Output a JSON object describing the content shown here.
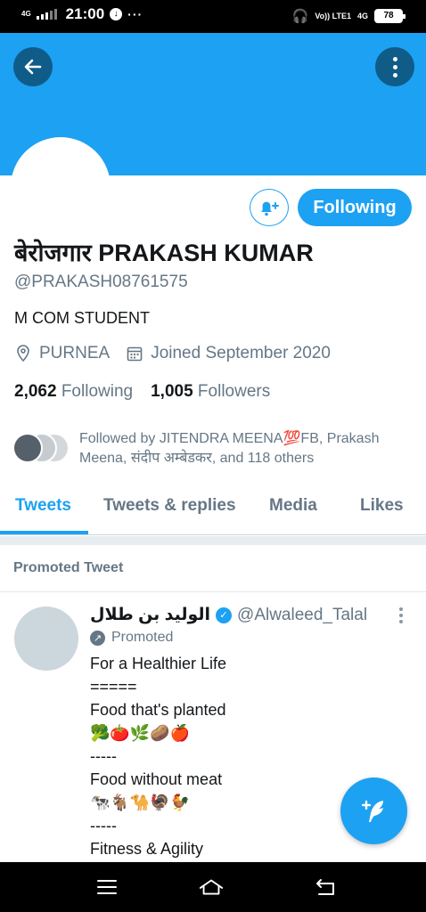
{
  "status_bar": {
    "network": "4G",
    "time": "21:00",
    "more": "···",
    "volte": "Vo)) LTE1",
    "net_right": "4G",
    "battery": "78"
  },
  "profile": {
    "name": "बेरोजगार PRAKASH KUMAR",
    "handle": "@PRAKASH08761575",
    "bio": "M COM STUDENT",
    "location": "PURNEA",
    "joined": "Joined September 2020",
    "following_count": "2,062",
    "following_label": "Following",
    "followers_count": "1,005",
    "followers_label": "Followers",
    "followed_by": "Followed by JITENDRA MEENA💯FB, Prakash Meena, संदीप अम्बेडकर, and 118 others"
  },
  "actions": {
    "follow_state": "Following"
  },
  "tabs": [
    {
      "label": "Tweets",
      "active": true
    },
    {
      "label": "Tweets & replies",
      "active": false
    },
    {
      "label": "Media",
      "active": false
    },
    {
      "label": "Likes",
      "active": false
    }
  ],
  "promoted_section": {
    "header": "Promoted Tweet"
  },
  "tweet": {
    "author_name": "الوليد بن طلال",
    "author_handle": "@Alwaleed_Talal",
    "promoted_label": "Promoted",
    "lines": [
      "For a Healthier Life",
      "=====",
      "Food that's planted",
      "🥦🍅🌿🥔🍎",
      "-----",
      "Food without meat",
      "🐄🐐🐪🦃🐓",
      "-----",
      "Fitness & Agility",
      "🏃🚴🏊"
    ]
  },
  "colors": {
    "accent": "#1da1f2",
    "dark_button": "#0f5c89",
    "secondary_text": "#657786",
    "primary_text": "#14171a"
  }
}
